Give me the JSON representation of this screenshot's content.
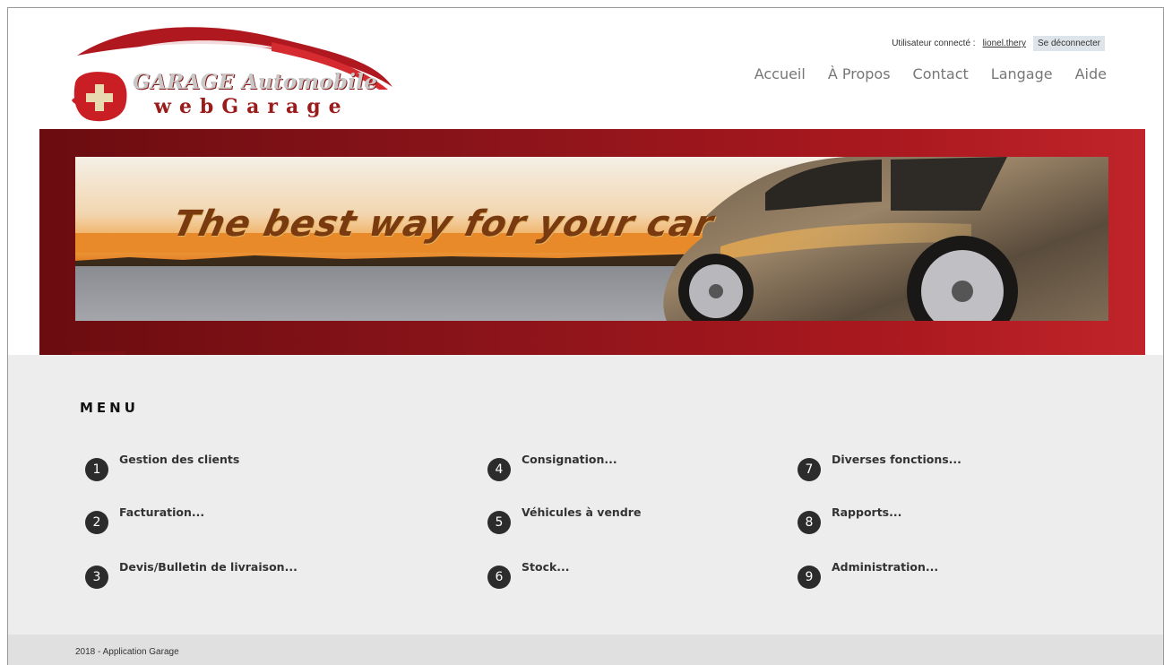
{
  "header": {
    "logo": {
      "title": "GARAGE Automobile",
      "subtitle": "webGarage"
    },
    "user_label": "Utilisateur connecté :",
    "username": "lionel.thery",
    "logout": "Se déconnecter",
    "nav": [
      "Accueil",
      "À Propos",
      "Contact",
      "Langage",
      "Aide"
    ]
  },
  "banner": {
    "tagline": "The best way for your car"
  },
  "menu": {
    "title": "MENU",
    "items": [
      {
        "num": "1",
        "label": "Gestion des clients"
      },
      {
        "num": "2",
        "label": "Facturation..."
      },
      {
        "num": "3",
        "label": "Devis/Bulletin de livraison..."
      },
      {
        "num": "4",
        "label": "Consignation..."
      },
      {
        "num": "5",
        "label": "Véhicules à vendre"
      },
      {
        "num": "6",
        "label": "Stock..."
      },
      {
        "num": "7",
        "label": "Diverses fonctions..."
      },
      {
        "num": "8",
        "label": "Rapports..."
      },
      {
        "num": "9",
        "label": "Administration..."
      }
    ]
  },
  "footer": {
    "text": "2018 - Application Garage"
  },
  "colors": {
    "brand_red": "#a8181e",
    "dark_red": "#6b0c10",
    "main_bg": "#ededed",
    "nav_text": "#777777"
  }
}
